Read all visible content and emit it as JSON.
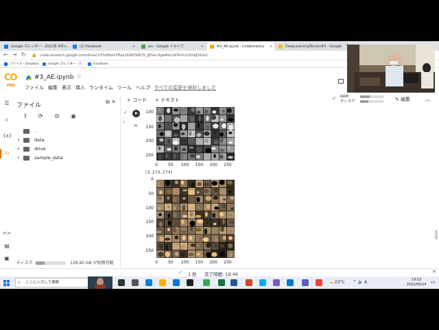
{
  "browser": {
    "tabs": [
      {
        "label": "Google カレンダー - 2022年 9月 ...",
        "color": "#1a73e8",
        "active": false
      },
      {
        "label": "(1) Facebook",
        "color": "#1877f2",
        "active": false
      },
      {
        "label": "pic - Google ドライブ",
        "color": "#34a853",
        "active": false
      },
      {
        "label": "#3_AE.ipynb - Colaboratory",
        "color": "#f9ab00",
        "active": true
      },
      {
        "label": "DeepLearningTerrain#3 - Google ...",
        "color": "#fbbc04",
        "active": false
      }
    ],
    "url": "colab.research.google.com/drive/1rFmHbsi1YHqo16dbTbW3S_jjEGe-Ogw#scrollTo=Lm3mdJ3A2eC",
    "bookmarks": [
      {
        "label": "ファイル - Dropbox",
        "color": "#0061fe"
      },
      {
        "label": "Google カレンダー - 2...",
        "color": "#1a73e8"
      },
      {
        "label": "Facebook",
        "color": "#1877f2"
      }
    ]
  },
  "colab": {
    "logo": "CO",
    "pro": "PRO",
    "notebook_title": "#3_AE.ipynb",
    "menu": [
      "ファイル",
      "編集",
      "表示",
      "挿入",
      "ランタイム",
      "ツール",
      "ヘルプ"
    ],
    "saved_status": "すべての変更を保存しました",
    "add_code": "+ コード",
    "add_text": "+ テキスト",
    "ram_label": "RAM",
    "disk_label": "ディスク",
    "ram_level": 0.4,
    "disk_level": 0.35,
    "edit_label": "編集"
  },
  "file_panel": {
    "title": "ファイル",
    "tree": [
      {
        "label": "..",
        "has_arrow": false
      },
      {
        "label": "data",
        "has_arrow": true
      },
      {
        "label": "drive",
        "has_arrow": true
      },
      {
        "label": "sample_data",
        "has_arrow": true
      }
    ],
    "disk_label": "ディスク",
    "disk_text": "128.90 GB が利用可能",
    "disk_used_fraction": 0.3
  },
  "cell": {
    "number": "1\n秒",
    "plot1_yticks": [
      "100",
      "150",
      "200",
      "250"
    ],
    "plot1_xticks": [
      "0",
      "50",
      "100",
      "150",
      "200",
      "250"
    ],
    "shape_output": "(3, 274, 274)",
    "plot2_yticks": [
      "0",
      "50",
      "100",
      "150",
      "200",
      "250"
    ],
    "plot2_xticks": [
      "0",
      "50",
      "100",
      "150",
      "200",
      "250"
    ]
  },
  "status": {
    "time": "1 秒",
    "done": "完了時間: 19:49"
  },
  "taskbar": {
    "search_placeholder": "ここに入力して検索",
    "temperature": "23°C",
    "ime": "A",
    "time": "19:53",
    "date": "2022/09/24"
  }
}
